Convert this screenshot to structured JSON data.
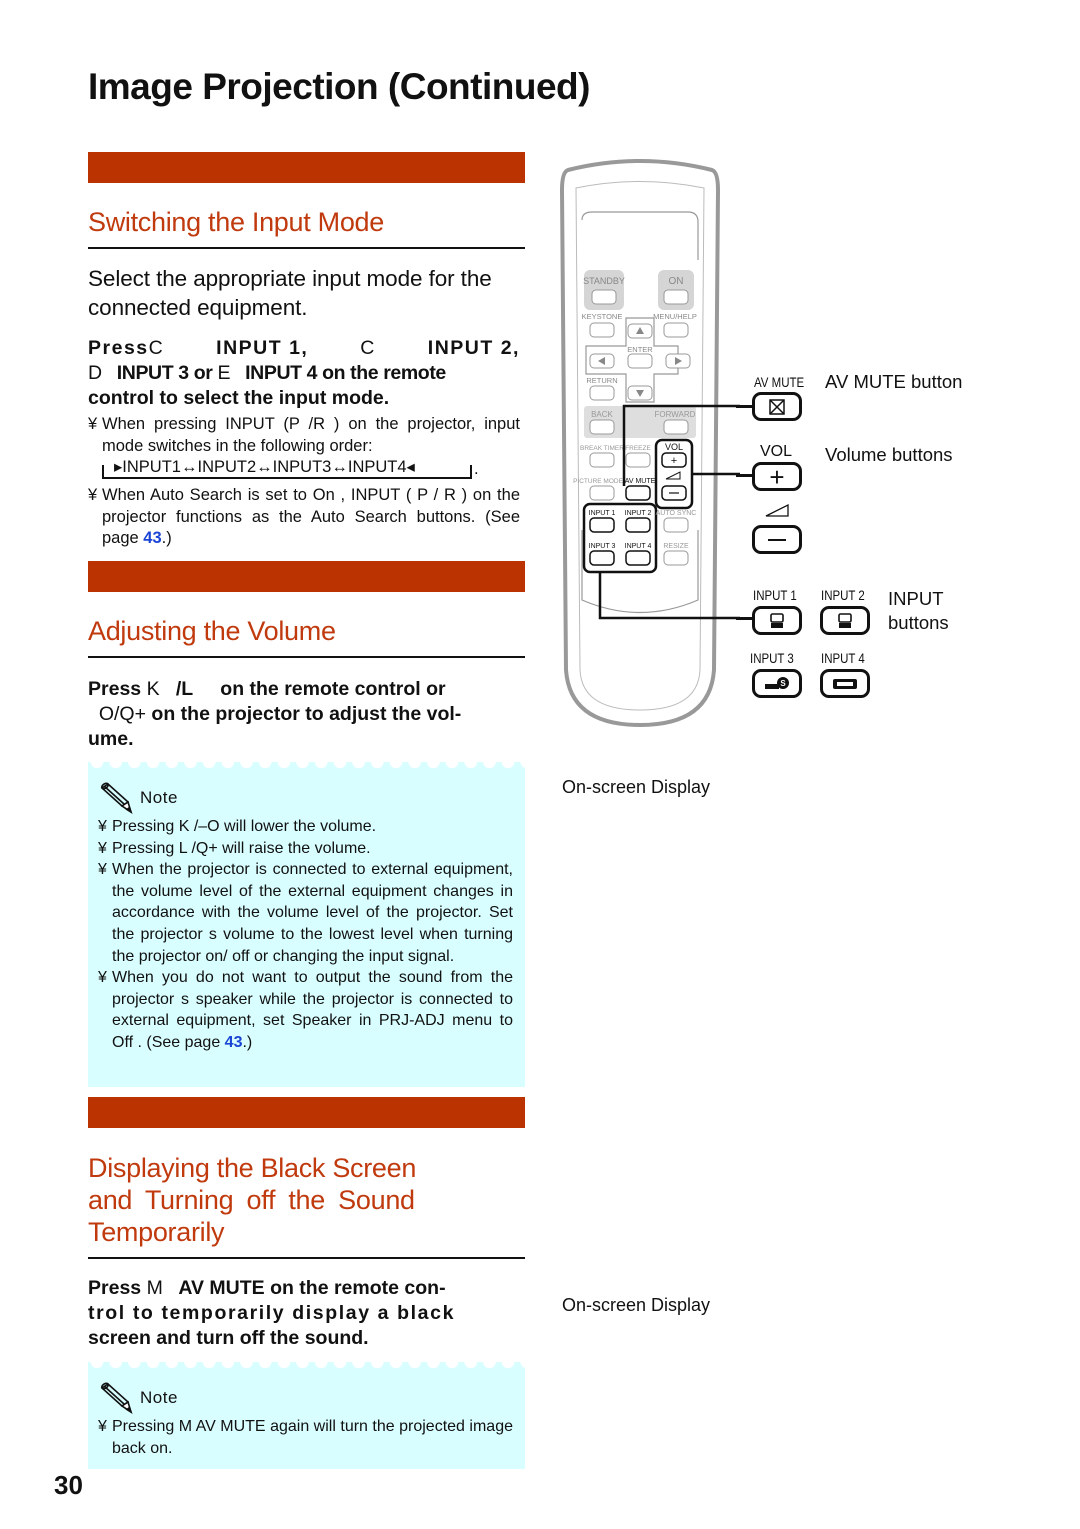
{
  "page": {
    "title": "Image Projection (Continued)",
    "page_number": "30"
  },
  "colors": {
    "section_bar": "#bb3300",
    "section_title": "#c03a0e",
    "note_background": "#d9feff",
    "link": "#1a44d6"
  },
  "sections": [
    {
      "title": "Switching the Input Mode",
      "intro": "Select the appropriate input mode for the connected equipment.",
      "instruction": {
        "line1": [
          "Press",
          "C",
          "INPUT 1,",
          "C",
          "INPUT 2,"
        ],
        "line2": [
          "D",
          "INPUT 3 or",
          "E",
          "INPUT 4 on the remote"
        ],
        "line3": "control to select the input mode."
      },
      "bullets": [
        {
          "marker": "¥",
          "text": "When pressing INPUT (P /R ) on the projector, input mode switches in the following order:"
        },
        {
          "marker": "¥",
          "text": "When  Auto Search  is set to  On , INPUT ( P / R ) on the projector functions as the Auto Search buttons. (See page ",
          "link": "43",
          "suffix": ".)"
        }
      ],
      "cycle": [
        "INPUT1",
        "INPUT2",
        "INPUT3",
        "INPUT4"
      ]
    },
    {
      "title": "Adjusting the Volume",
      "instruction": {
        "line1": [
          "Press",
          "K",
          "/L",
          "on the remote control or"
        ],
        "line2": [
          "O/Q+",
          "on the projector to adjust the vol-"
        ],
        "line3": "ume."
      },
      "note": {
        "heading": "Note",
        "bullets": [
          {
            "marker": "¥",
            "text": "Pressing K   /–O  will lower the volume."
          },
          {
            "marker": "¥",
            "text": "Pressing L   /Q+ will raise the volume."
          },
          {
            "marker": "¥",
            "text": "When the projector is connected to external equipment, the volume level of the external equipment changes in accordance with the volume level of the projector. Set the projector s volume to the lowest level when turning the projector on/ off or changing the input signal."
          },
          {
            "marker": "¥",
            "text": "When you do not want to output the sound from the projector s speaker while the projector is connected to external equipment, set  Speaker  in  PRJ-ADJ  menu to  Off . (See page ",
            "link": "43",
            "suffix": ".)"
          }
        ]
      },
      "osd_label": "On-screen Display"
    },
    {
      "title_lines": [
        "Displaying the Black Screen",
        "and Turning off the Sound",
        "Temporarily"
      ],
      "instruction": {
        "line1": [
          "Press",
          "M",
          "AV MUTE on the remote con-"
        ],
        "line2": "trol to temporarily display a black",
        "line3": "screen and turn off the sound."
      },
      "note": {
        "heading": "Note",
        "bullets": [
          {
            "marker": "¥",
            "text": "Pressing M   AV MUTE again will turn the projected image back on."
          }
        ]
      },
      "osd_label": "On-screen Display"
    }
  ],
  "remote": {
    "buttons": {
      "standby": "STANDBY",
      "on": "ON",
      "keystone": "KEYSTONE",
      "menu_help": "MENU/HELP",
      "enter": "ENTER",
      "return": "RETURN",
      "back": "BACK",
      "forward": "FORWARD",
      "break_timer": "BREAK TIMER",
      "freeze": "FREEZE",
      "vol": "VOL",
      "picture_mode": "PICTURE MODE",
      "av_mute": "AV MUTE",
      "input1": "INPUT 1",
      "input2": "INPUT 2",
      "auto_sync": "AUTO SYNC",
      "input3": "INPUT 3",
      "input4": "INPUT 4",
      "resize": "RESIZE"
    },
    "callouts": {
      "av_mute_label": "AV MUTE",
      "av_mute_desc": "AV MUTE button",
      "vol_label": "VOL",
      "vol_desc": "Volume buttons",
      "input1_label": "INPUT 1",
      "input2_label": "INPUT 2",
      "input3_label": "INPUT 3",
      "input4_label": "INPUT 4",
      "input_desc_1": "INPUT",
      "input_desc_2": "buttons"
    }
  }
}
